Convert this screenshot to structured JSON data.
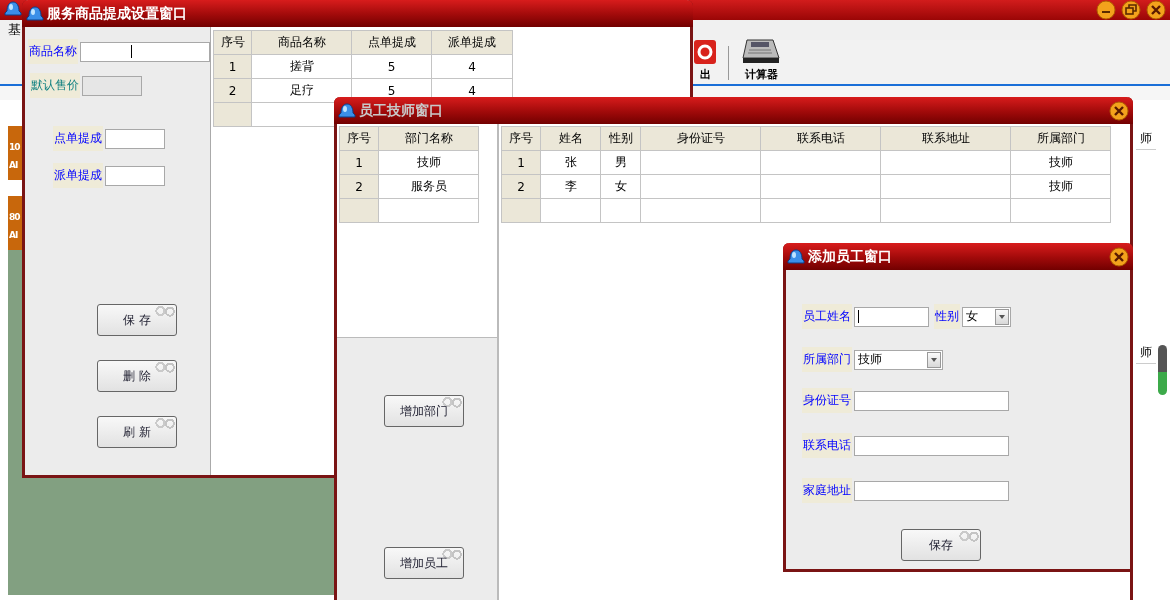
{
  "main_window": {
    "menu": [
      "基"
    ],
    "toolbar": [
      {
        "kind": "exit",
        "label": "出"
      },
      {
        "kind": "calculator",
        "label": "计算器"
      }
    ],
    "tiles": [
      {
        "line1": "10",
        "line2": "AI"
      },
      {
        "line1": "80",
        "line2": "AI"
      }
    ],
    "behind_cells": [
      "师",
      "师"
    ]
  },
  "commission_window": {
    "title": "服务商品提成设置窗口",
    "active": true,
    "fields": [
      {
        "label": "商品名称",
        "disabled": false,
        "focused": true
      },
      {
        "label": "默认售价",
        "disabled": true,
        "focused": false
      },
      {
        "label": "点单提成",
        "disabled": false,
        "focused": false
      },
      {
        "label": "派单提成",
        "disabled": false,
        "focused": false
      }
    ],
    "buttons": [
      "保 存",
      "删 除",
      "刷 新"
    ],
    "table": {
      "columns": [
        "序号",
        "商品名称",
        "点单提成",
        "派单提成"
      ],
      "rows": [
        {
          "no": "1",
          "name": "搓背",
          "order": "5",
          "dispatch": "4"
        },
        {
          "no": "2",
          "name": "足疗",
          "order": "5",
          "dispatch": "4"
        }
      ]
    }
  },
  "staff_window": {
    "title": "员工技师窗口",
    "active": false,
    "departments": {
      "columns": [
        "序号",
        "部门名称"
      ],
      "rows": [
        {
          "no": "1",
          "name": "技师"
        },
        {
          "no": "2",
          "name": "服务员"
        }
      ]
    },
    "buttons": [
      "增加部门",
      "增加员工"
    ],
    "employees": {
      "columns": [
        "序号",
        "姓名",
        "性别",
        "身份证号",
        "联系电话",
        "联系地址",
        "所属部门"
      ],
      "rows": [
        {
          "no": "1",
          "name": "张",
          "gender": "男",
          "department": "技师"
        },
        {
          "no": "2",
          "name": "李",
          "gender": "女",
          "department": "技师"
        }
      ]
    }
  },
  "add_window": {
    "title": "添加员工窗口",
    "active": true,
    "rows": [
      [
        {
          "kind": "text",
          "label": "员工姓名",
          "focused": true
        },
        {
          "kind": "select",
          "label": "性别",
          "value": "女"
        }
      ],
      [
        {
          "kind": "select",
          "label": "所属部门",
          "value": "技师"
        }
      ],
      [
        {
          "kind": "text",
          "label": "身份证号",
          "focused": false
        }
      ],
      [
        {
          "kind": "text",
          "label": "联系电话",
          "focused": false
        }
      ],
      [
        {
          "kind": "text",
          "label": "家庭地址",
          "focused": false
        }
      ]
    ],
    "button": "保存"
  }
}
